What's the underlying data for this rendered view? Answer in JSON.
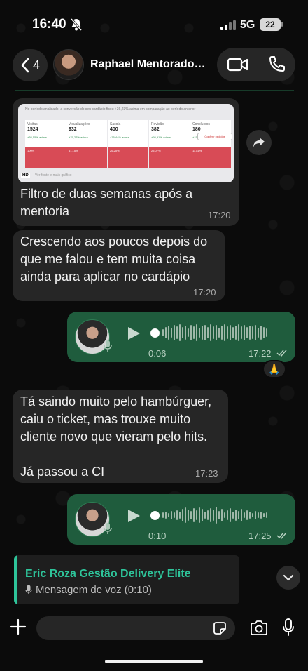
{
  "status_bar": {
    "time": "16:40",
    "network": "5G",
    "battery": "22"
  },
  "header": {
    "back_count": "4",
    "contact_name": "Raphael Mentorado…"
  },
  "messages": {
    "m1": {
      "image_top_text": "No período analisado, a conversão do seu cardápio ficou +36,23% acima em comparação ao período anterior",
      "stats": [
        {
          "label": "Visitas",
          "value": "1524",
          "delta": "+38,55% acima"
        },
        {
          "label": "Visualizações",
          "value": "932",
          "delta": "+79,27% acima"
        },
        {
          "label": "Sacola",
          "value": "400",
          "delta": "+75,44% acima"
        },
        {
          "label": "Revisão",
          "value": "382",
          "delta": "+93,91% acima"
        },
        {
          "label": "Concluídos",
          "value": "180",
          "delta": "+156,77% acima"
        }
      ],
      "bars": [
        "100%",
        "61,15%",
        "26,25%",
        "25,07%",
        "11,81%"
      ],
      "cta": "Conferir pedidos",
      "image_bottom_text": "Ver fonte e mais gráfico",
      "hd": "HD",
      "text": "Filtro de duas semanas após a mentoria",
      "time": "17:20"
    },
    "m2": {
      "text": "Crescendo aos poucos depois do que me falou e tem muita coisa ainda para aplicar no cardápio",
      "time": "17:20"
    },
    "m3": {
      "duration": "0:06",
      "time": "17:22",
      "reaction": "🙏"
    },
    "m4": {
      "text": "Tá saindo muito pelo hambúrguer, caiu o ticket, mas trouxe muito cliente novo que vieram pelo hits.\n\nJá passou a CI",
      "time": "17:23"
    },
    "m5": {
      "duration": "0:10",
      "time": "17:25"
    }
  },
  "reply": {
    "name": "Eric Roza Gestão Delivery Elite",
    "subtitle": "Mensagem de voz (0:10)"
  },
  "input": {
    "placeholder": ""
  },
  "colors": {
    "accent": "#2ec49a",
    "outgoing": "#1f5c3d",
    "incoming": "#262626"
  }
}
